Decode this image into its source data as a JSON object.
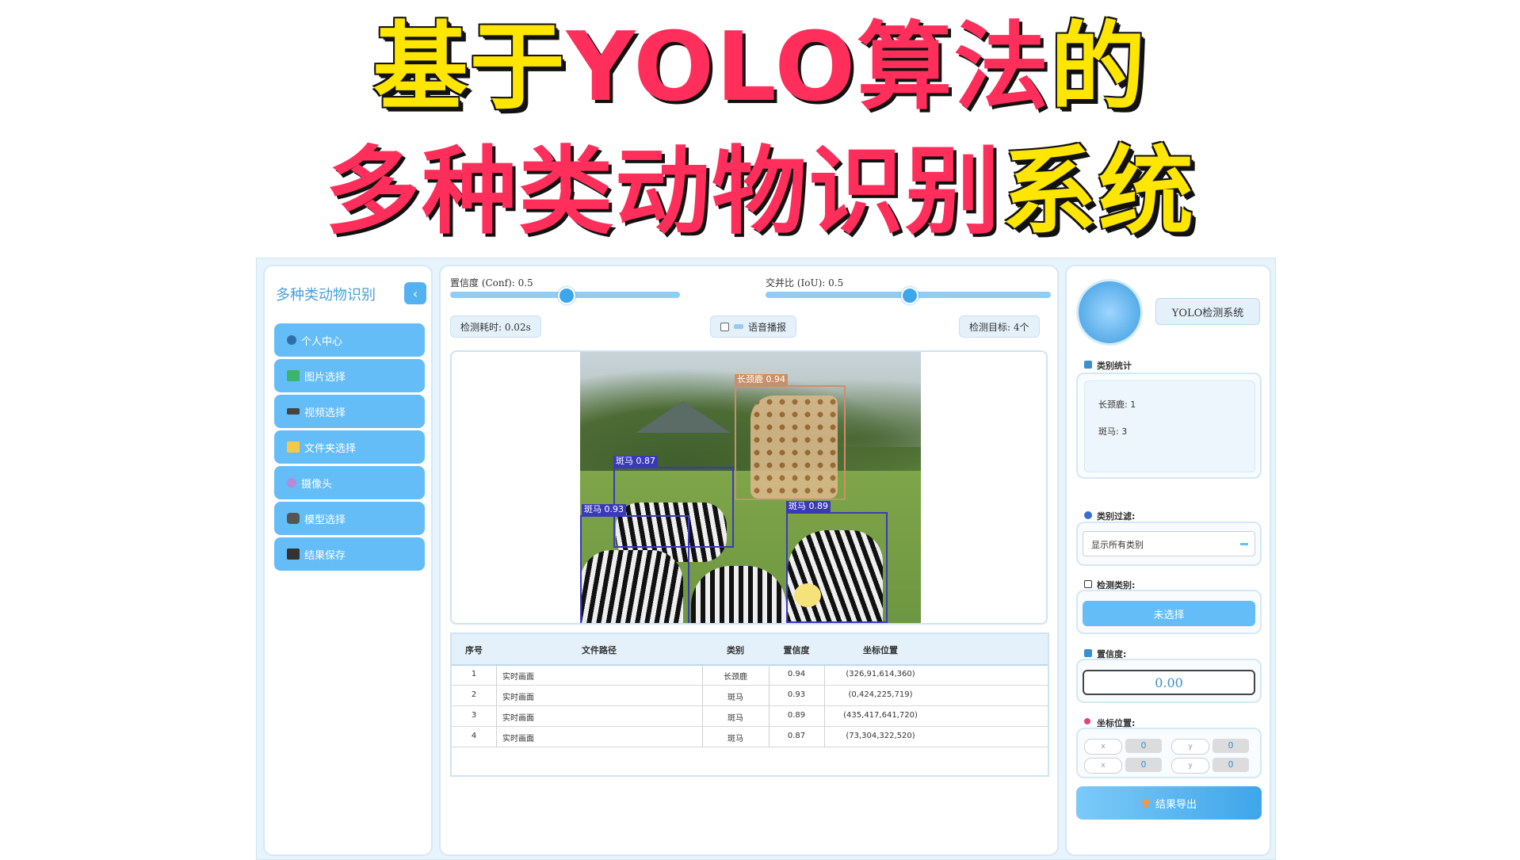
{
  "banner": {
    "line1_part1": "基于",
    "line1_part2": "YOLO算法",
    "line1_part3": "的",
    "line2_part1": "多种类动物识别",
    "line2_part2": "系统"
  },
  "sidebar": {
    "title": "多种类动物识别",
    "collapse_icon": "chevron-left-icon",
    "items": [
      {
        "label": "个人中心",
        "icon": "user-icon"
      },
      {
        "label": "图片选择",
        "icon": "image-icon"
      },
      {
        "label": "视频选择",
        "icon": "video-icon"
      },
      {
        "label": "文件夹选择",
        "icon": "folder-icon"
      },
      {
        "label": "摄像头",
        "icon": "camera-icon"
      },
      {
        "label": "模型选择",
        "icon": "model-icon"
      },
      {
        "label": "结果保存",
        "icon": "save-icon"
      }
    ]
  },
  "controls": {
    "conf_label": "置信度 (Conf): 0.5",
    "conf_value": 0.5,
    "iou_label": "交并比 (IoU): 0.5",
    "iou_value": 0.5,
    "time_label": "检测耗时: 0.02s",
    "voice_label": "语音播报",
    "target_label": "检测目标: 4个"
  },
  "detections": [
    {
      "label": "长颈鹿 0.94",
      "color": "#c8906a"
    },
    {
      "label": "斑马 0.87",
      "color": "#3a3ab8"
    },
    {
      "label": "斑马 0.93",
      "color": "#3a3ab8"
    },
    {
      "label": "斑马 0.89",
      "color": "#3a3ab8"
    }
  ],
  "table": {
    "headers": [
      "序号",
      "文件路径",
      "类别",
      "置信度",
      "坐标位置"
    ],
    "rows": [
      [
        "1",
        "实时画面",
        "长颈鹿",
        "0.94",
        "(326,91,614,360)"
      ],
      [
        "2",
        "实时画面",
        "斑马",
        "0.93",
        "(0,424,225,719)"
      ],
      [
        "3",
        "实时画面",
        "斑马",
        "0.89",
        "(435,417,641,720)"
      ],
      [
        "4",
        "实时画面",
        "斑马",
        "0.87",
        "(73,304,322,520)"
      ]
    ]
  },
  "right": {
    "system_label": "YOLO检测系统",
    "stats_title": "类别统计",
    "stats": [
      "长颈鹿: 1",
      "斑马: 3"
    ],
    "filter_title": "类别过滤:",
    "filter_value": "显示所有类别",
    "detect_class_title": "检测类别:",
    "detect_class_value": "未选择",
    "conf_title": "置信度:",
    "conf_value": "0.00",
    "coord_title": "坐标位置:",
    "coord_pills": [
      "x",
      "y",
      "x",
      "y"
    ],
    "coord_values": [
      "0",
      "0",
      "0",
      "0"
    ],
    "export_label": "结果导出"
  },
  "colors": {
    "accent": "#64bdf7",
    "accent_dark": "#3ea6ea",
    "panel_border": "#d5e8f6",
    "zebra_box": "#3a3ab8",
    "giraffe_box": "#c8906a"
  }
}
